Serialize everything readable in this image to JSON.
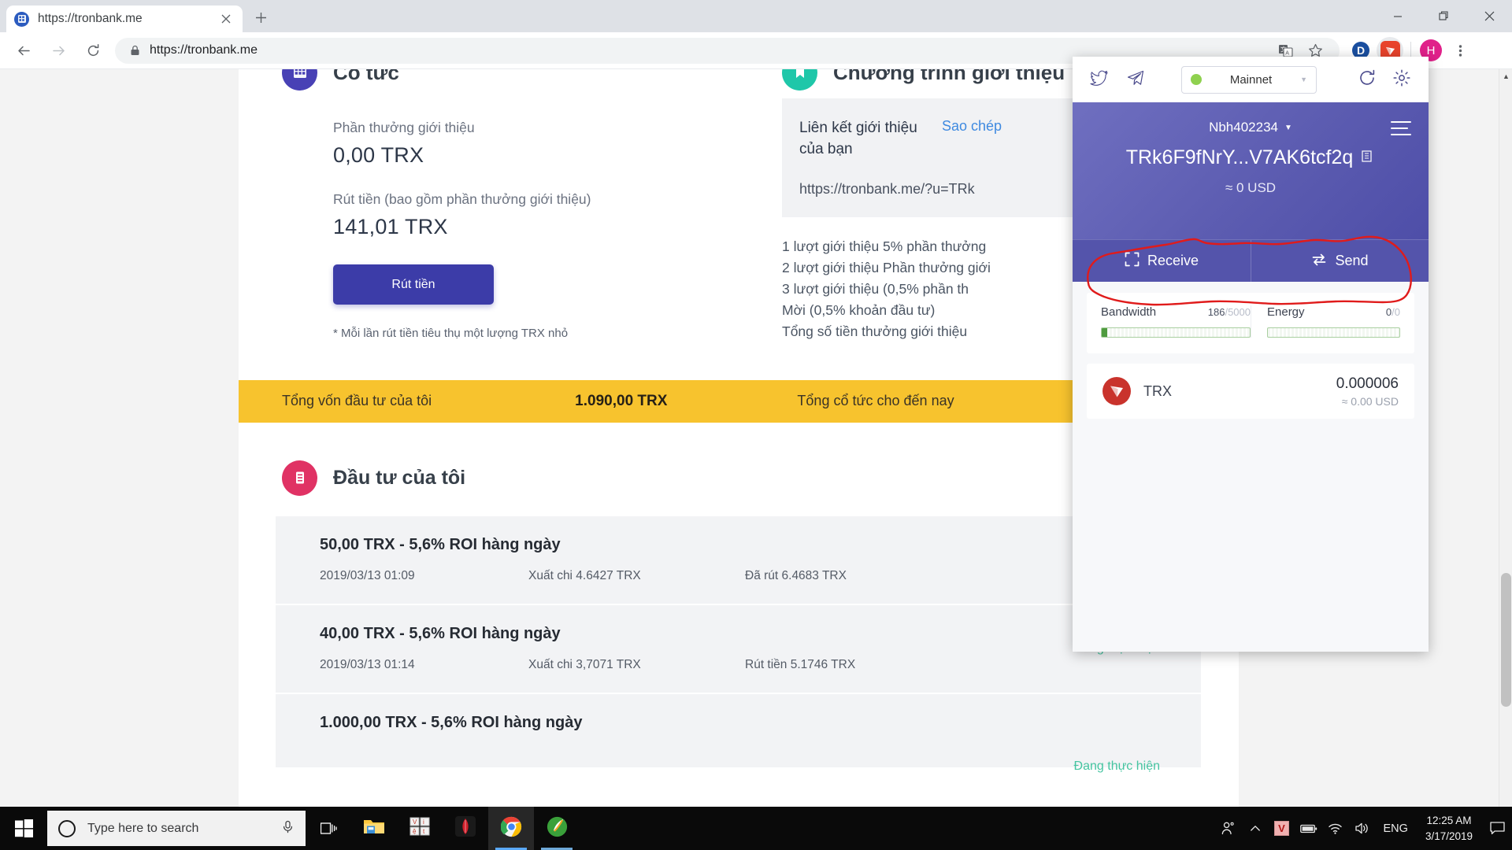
{
  "browser": {
    "tab": {
      "title": "https://tronbank.me",
      "favicon_icon": "tronbank-favicon",
      "close_icon": "close-icon"
    },
    "newtab_icon": "new-tab-icon",
    "window_controls": {
      "minimize_icon": "minimize-icon",
      "maximize_icon": "maximize-icon",
      "close_icon": "close-window-icon"
    },
    "nav": {
      "back_icon": "back-arrow-icon",
      "forward_icon": "forward-arrow-icon",
      "reload_icon": "reload-icon"
    },
    "omnibox": {
      "lock_icon": "lock-icon",
      "url": "https://tronbank.me"
    },
    "toolbar": {
      "translate_icon": "translate-icon",
      "bookmark_icon": "star-icon",
      "extension_d_label": "D",
      "extension_tronlink_icon": "tronlink-extension-icon",
      "profile_initial": "H",
      "menu_icon": "three-dot-menu-icon"
    }
  },
  "page": {
    "dividend_card": {
      "icon": "dividend-grid-icon",
      "title": "Cổ tức",
      "referral_reward_label": "Phần thưởng giới thiệu",
      "referral_reward_value": "0,00 TRX",
      "withdraw_label": "Rút tiền (bao gồm phần thưởng giới thiệu)",
      "withdraw_value": "141,01 TRX",
      "withdraw_button": "Rút tiền",
      "note": "* Mỗi lần rút tiền tiêu thụ một lượng TRX nhỏ"
    },
    "referral_card": {
      "icon": "referral-badge-icon",
      "title": "Chương trình giới thiệu",
      "link_label": "Liên kết giới thiệu của bạn",
      "copy_label": "Sao chép",
      "link_url": "https://tronbank.me/?u=TRk",
      "rules": [
        "1 lượt giới thiệu 5% phần thưởng",
        "2 lượt giới thiệu Phần thưởng giới",
        "3 lượt giới thiệu   (0,5% phần th",
        "Mời (0,5% khoản đầu tư)",
        "Tổng số tiền thưởng giới thiệu"
      ]
    },
    "summary": {
      "total_invest_label": "Tổng vốn đầu tư của tôi",
      "total_invest_value": "1.090,00 TRX",
      "total_dividend_label": "Tổng cổ tức cho đến nay"
    },
    "investments": {
      "icon": "investment-list-icon",
      "title": "Đầu tư của tôi",
      "rows": [
        {
          "amount": "50,00 TRX - 5,6% ROI hàng ngày",
          "date": "2019/03/13 01:09",
          "paid": "Xuất chi 4.6427 TRX",
          "withdrawn": "Đã rút 6.4683 TRX",
          "status": ""
        },
        {
          "amount": "40,00 TRX - 5,6% ROI hàng ngày",
          "date": "2019/03/13 01:14",
          "paid": "Xuất chi 3,7071 TRX",
          "withdrawn": "Rút tiền 5.1746 TRX",
          "status": "Đang thực hiện"
        },
        {
          "amount": "1.000,00 TRX - 5,6% ROI hàng ngày",
          "date": "",
          "paid": "",
          "withdrawn": "",
          "status": "Đang thực hiện"
        }
      ]
    }
  },
  "tronlink": {
    "top": {
      "twitter_icon": "twitter-icon",
      "telegram_icon": "telegram-icon",
      "network": "Mainnet",
      "network_caret_icon": "chevron-down-icon",
      "refresh_icon": "refresh-icon",
      "settings_icon": "gear-icon"
    },
    "account": {
      "name": "Nbh402234",
      "name_caret_icon": "chevron-down-icon",
      "menu_icon": "hamburger-menu-icon",
      "address": "TRk6F9fNrY...V7AK6tcf2q",
      "copy_icon": "copy-icon",
      "usd_value": "≈ 0 USD"
    },
    "actions": {
      "receive_label": "Receive",
      "receive_icon": "qr-scan-icon",
      "send_label": "Send",
      "send_icon": "send-arrows-icon"
    },
    "resources": {
      "bandwidth_label": "Bandwidth",
      "bandwidth_used": "186",
      "bandwidth_total": "/5000",
      "bandwidth_percent": 3.7,
      "energy_label": "Energy",
      "energy_used": "0",
      "energy_total": "/0",
      "energy_percent": 0
    },
    "token": {
      "icon": "tron-coin-icon",
      "name": "TRX",
      "amount": "0.000006",
      "usd": "≈ 0.00 USD"
    },
    "annotation_color": "#e01b1b"
  },
  "taskbar": {
    "start_icon": "windows-start-icon",
    "search_placeholder": "Type here to search",
    "search_circle_icon": "cortana-circle-icon",
    "mic_icon": "microphone-icon",
    "taskview_icon": "task-view-icon",
    "apps": [
      {
        "name": "file-explorer",
        "icon": "folder-icon"
      },
      {
        "name": "unikey",
        "icon": "unikey-icon"
      },
      {
        "name": "tor-browser",
        "icon": "tor-icon"
      },
      {
        "name": "google-chrome",
        "icon": "chrome-icon"
      },
      {
        "name": "coc-coc-browser",
        "icon": "coccoc-icon"
      }
    ],
    "tray": {
      "people_icon": "people-icon",
      "chevron_icon": "show-hidden-icons-icon",
      "antivirus_icon": "antivirus-v-icon",
      "battery_icon": "battery-icon",
      "wifi_icon": "wifi-icon",
      "volume_icon": "speaker-icon",
      "language": "ENG",
      "time": "12:25 AM",
      "date": "3/17/2019",
      "action_center_icon": "action-center-icon"
    }
  }
}
